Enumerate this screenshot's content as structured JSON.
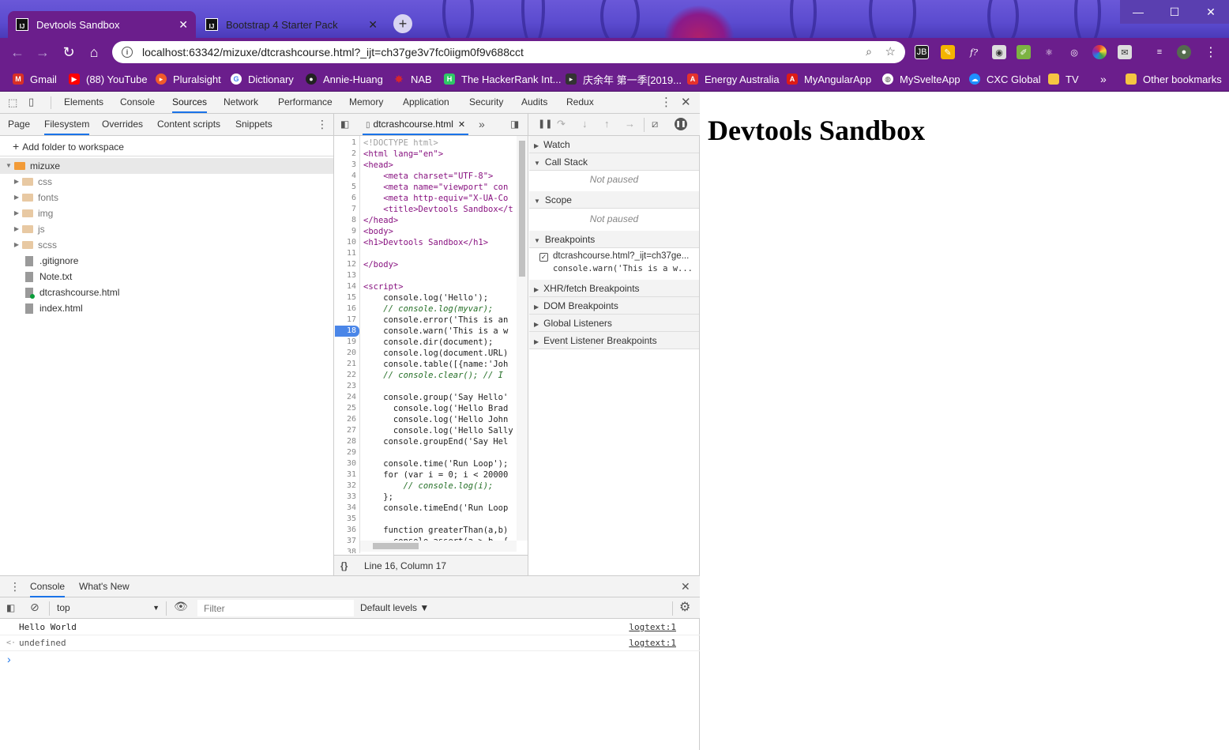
{
  "browser": {
    "tabs": [
      {
        "title": "Devtools Sandbox",
        "active": true
      },
      {
        "title": "Bootstrap 4 Starter Pack",
        "active": false
      }
    ],
    "new_tab": "+",
    "url": "localhost:63342/mizuxe/dtcrashcourse.html?_ijt=ch37ge3v7fc0iigm0f9v688cct",
    "window_controls": {
      "minimize": "—",
      "maximize": "☐",
      "close": "✕"
    },
    "nav": {
      "back": "←",
      "forward": "→",
      "reload": "↻",
      "home": "⌂"
    },
    "bookmarks": [
      {
        "label": "Gmail",
        "color": "#d93025"
      },
      {
        "label": "(88) YouTube",
        "color": "#ff0000"
      },
      {
        "label": "Pluralsight",
        "color": "#f15b2a"
      },
      {
        "label": "Dictionary",
        "color": "#4285f4"
      },
      {
        "label": "Annie-Huang",
        "color": "#222222"
      },
      {
        "label": "NAB",
        "color": "#d7262e"
      },
      {
        "label": "The HackerRank Int...",
        "color": "#2ec866"
      },
      {
        "label": "庆余年 第一季[2019...",
        "color": "#333333"
      },
      {
        "label": "Energy Australia",
        "color": "#e5322d"
      },
      {
        "label": "MyAngularApp",
        "color": "#dd1b16"
      },
      {
        "label": "MySvelteApp",
        "color": "#888888"
      },
      {
        "label": "CXC Global",
        "color": "#1e90ff"
      },
      {
        "label": "TV",
        "color": "#f5c542"
      }
    ],
    "bookmarks_overflow": "»",
    "other_bookmarks": "Other bookmarks"
  },
  "devtools": {
    "main_tabs": [
      "Elements",
      "Console",
      "Sources",
      "Network",
      "Performance",
      "Memory",
      "Application",
      "Security",
      "Audits",
      "Redux"
    ],
    "selected_main_tab": "Sources",
    "navigator_tabs": [
      "Page",
      "Filesystem",
      "Overrides",
      "Content scripts",
      "Snippets"
    ],
    "selected_navigator_tab": "Filesystem",
    "add_folder": "Add folder to workspace",
    "tree": {
      "root": "mizuxe",
      "folders": [
        "css",
        "fonts",
        "img",
        "js",
        "scss"
      ],
      "files": [
        ".gitignore",
        "Note.txt",
        "dtcrashcourse.html",
        "index.html"
      ]
    },
    "editor_tab": "dtcrashcourse.html",
    "code_lines": [
      "<!DOCTYPE html>",
      "<html lang=\"en\">",
      "<head>",
      "    <meta charset=\"UTF-8\">",
      "    <meta name=\"viewport\" con",
      "    <meta http-equiv=\"X-UA-Co",
      "    <title>Devtools Sandbox</t",
      "</head>",
      "<body>",
      "<h1>Devtools Sandbox</h1>",
      "",
      "</body>",
      "",
      "<script>",
      "    console.log('Hello');",
      "    // console.log(myvar);",
      "    console.error('This is an",
      "    console.warn('This is a w",
      "    console.dir(document);",
      "    console.log(document.URL)",
      "    console.table([{name:'Joh",
      "    // console.clear(); // I ",
      "",
      "    console.group('Say Hello'",
      "      console.log('Hello Brad",
      "      console.log('Hello John",
      "      console.log('Hello Sally",
      "    console.groupEnd('Say Hel",
      "",
      "    console.time('Run Loop');",
      "    for (var i = 0; i < 20000",
      "        // console.log(i);",
      "    };",
      "    console.timeEnd('Run Loop",
      "",
      "    function greaterThan(a,b)",
      "      console.assert(a > b, {",
      ""
    ],
    "breakpoint_line": 18,
    "status": "Line 16, Column 17",
    "format_icon": "{}",
    "debugger": {
      "sections": [
        "Watch",
        "Call Stack",
        "Scope",
        "Breakpoints",
        "XHR/fetch Breakpoints",
        "DOM Breakpoints",
        "Global Listeners",
        "Event Listener Breakpoints"
      ],
      "not_paused": "Not paused",
      "breakpoint_file": "dtcrashcourse.html?_ijt=ch37ge...",
      "breakpoint_code": "console.warn('This is a w..."
    },
    "drawer": {
      "tabs": [
        "Console",
        "What's New"
      ],
      "context": "top",
      "filter_placeholder": "Filter",
      "levels": "Default levels ▼",
      "messages": [
        {
          "text": "Hello World",
          "source": "logtext:1",
          "prefix": ""
        },
        {
          "text": "undefined",
          "source": "logtext:1",
          "prefix": "<·"
        }
      ],
      "prompt": "›"
    }
  },
  "page": {
    "heading": "Devtools Sandbox"
  }
}
